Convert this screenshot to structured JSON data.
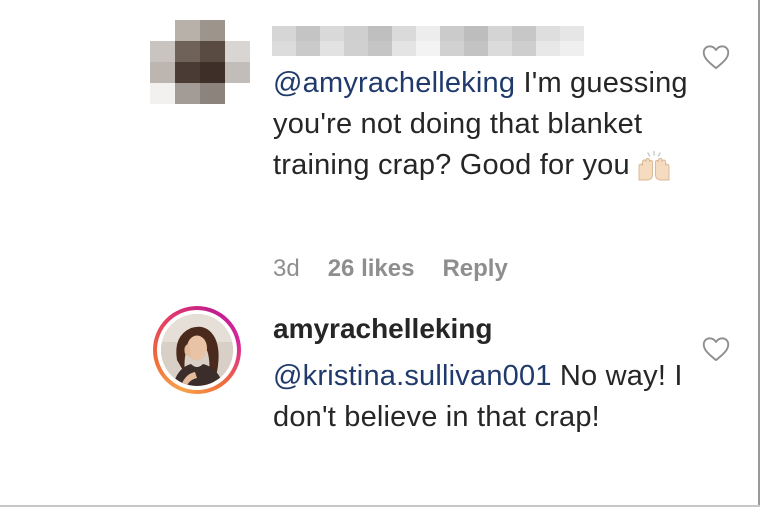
{
  "comment_1": {
    "mention": "@amyrachelleking",
    "text": " I'm guessing you're not doing that blanket training crap? Good for you",
    "emoji_icon": "raised-hands-emoji",
    "time": "3d",
    "likes": "26 likes",
    "reply_label": "Reply"
  },
  "comment_2": {
    "username": "amyrachelleking",
    "mention": "@kristina.sullivan001",
    "text": " No way! I don't believe in that crap!"
  },
  "colors": {
    "text": "#262626",
    "mention": "#1f3a6b",
    "meta": "#8e8e8e",
    "heart": "#8e8e8e"
  },
  "icons": {
    "like": "heart-outline-icon"
  }
}
